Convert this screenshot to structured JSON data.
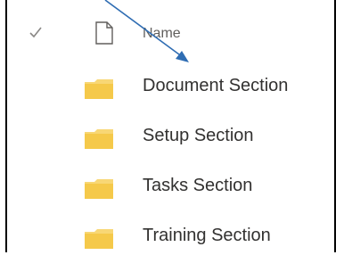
{
  "list": {
    "header": {
      "check_icon": "checkmark-icon",
      "type_icon": "document-icon",
      "name_label": "Name"
    },
    "items": [
      {
        "icon": "folder-icon",
        "label": "Document Section"
      },
      {
        "icon": "folder-icon",
        "label": "Setup Section"
      },
      {
        "icon": "folder-icon",
        "label": "Tasks Section"
      },
      {
        "icon": "folder-icon",
        "label": "Training Section"
      }
    ]
  },
  "colors": {
    "folder": "#f8d775",
    "arrow": "#2f6db3",
    "header_text": "#605e5c",
    "item_text": "#323130"
  }
}
